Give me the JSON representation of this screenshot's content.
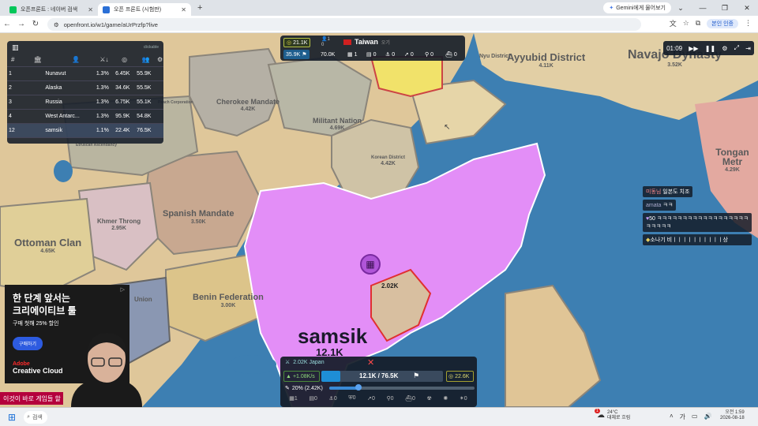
{
  "browser": {
    "tabs": [
      {
        "label": "오픈프론트 : 네이버 검색",
        "favicon_color": "#03c75a"
      },
      {
        "label": "오픈 프론트 (시험판)",
        "favicon_color": "#2a6fd6"
      }
    ],
    "new_tab": "+",
    "gemini_label": "Gemini에게 물어보기",
    "url": "openfront.io/w1/game/aUrPrzfp?live",
    "profile_label": "본인 인증"
  },
  "leaderboard": {
    "note": "clickable",
    "headers": [
      "#",
      "🏛",
      "👤",
      "⚔↓",
      "◎",
      "👥",
      "⚙"
    ],
    "rows": [
      {
        "rank": "1",
        "name": "Nunavut",
        "pct": "1.3%",
        "gold": "6.45K",
        "troops": "55.9K"
      },
      {
        "rank": "2",
        "name": "Alaska",
        "pct": "1.3%",
        "gold": "34.6K",
        "troops": "55.5K"
      },
      {
        "rank": "3",
        "name": "Russia",
        "pct": "1.3%",
        "gold": "6.75K",
        "troops": "55.1K"
      },
      {
        "rank": "4",
        "name": "West Antarc...",
        "pct": "1.3%",
        "gold": "95.9K",
        "troops": "54.8K"
      },
      {
        "rank": "12",
        "name": "samsik",
        "pct": "1.1%",
        "gold": "22.4K",
        "troops": "76.5K"
      }
    ]
  },
  "top_info": {
    "gold": "21.1K",
    "ally_count": "1",
    "ally_zero": "0",
    "country": "Taiwan",
    "country_tag": "오기",
    "troops": "35.9K",
    "pop": "70.0K",
    "buildings": [
      "1",
      "0",
      "0",
      "0",
      "0",
      "0"
    ]
  },
  "timer": {
    "time": "01:09"
  },
  "regions": [
    {
      "name": "Ayyubid District",
      "value": "4.11K"
    },
    {
      "name": "Navajo Dynasty",
      "value": "3.52K"
    },
    {
      "name": "Cherokee Mandate",
      "value": "4.42K"
    },
    {
      "name": "Militant Nation",
      "value": "4.69K"
    },
    {
      "name": "Korean District",
      "value": "4.42K"
    },
    {
      "name": "Spanish Mandate",
      "value": "3.50K"
    },
    {
      "name": "Khmer Throng",
      "value": "2.95K"
    },
    {
      "name": "Ottoman Clan",
      "value": "4.65K"
    },
    {
      "name": "Benin Federation",
      "value": "3.00K"
    },
    {
      "name": "Tongan Metr",
      "value": "4.29K"
    },
    {
      "name": "Etruscan Ascendancy",
      "value": ""
    },
    {
      "name": "Peach Corporation",
      "value": ""
    },
    {
      "name": "Nyu District",
      "value": ""
    },
    {
      "name": "Union",
      "value": ""
    }
  ],
  "player": {
    "name": "samsik",
    "value": "12.1K",
    "enemy_troops": "2.02K"
  },
  "chat": [
    {
      "user": "미동님",
      "text": "일본도 치조"
    },
    {
      "user": "amata",
      "text": "ㅋㅋ"
    },
    {
      "user": "50",
      "text": "ㅋㅋㅋㅋㅋㅋㅋㅋㅋㅋㅋㅋㅋㅋㅋㅋㅋㅋㅋㅋㅋㅋㅋ"
    },
    {
      "user": "소나기",
      "text": "비ㅣㅣㅣㅣㅣㅣㅣㅣㅣㅣ상"
    }
  ],
  "ad": {
    "line1": "한 단계 앞서는",
    "line2": "크리에이티브 툴",
    "line3": "구매 첫해 25% 할인",
    "cta": "구매하기",
    "brand1": "Adobe",
    "brand2": "Creative Cloud"
  },
  "watermark": "이것이 바로 게임들 할",
  "bottom_panel": {
    "attack_info": "2.02K Japan",
    "rate": "+1.08K/s",
    "troops": "12.1K / 76.5K",
    "gold": "22.6K",
    "attack_ratio": "20% (2.42K)",
    "attack_ratio_value": 0.2,
    "build_counts": [
      "1",
      "0",
      "0",
      "0",
      "0",
      "0",
      "0",
      "0"
    ]
  },
  "taskbar": {
    "search_placeholder": "검색",
    "weather_temp": "24°C",
    "weather_text": "대체로 흐림",
    "weather_badge": "1",
    "time": "오전 1:59",
    "date": "2026-08-18"
  },
  "colors": {
    "player_territory": "#e38ef7",
    "ocean": "#3d7fb2",
    "panel": "#141c28"
  }
}
